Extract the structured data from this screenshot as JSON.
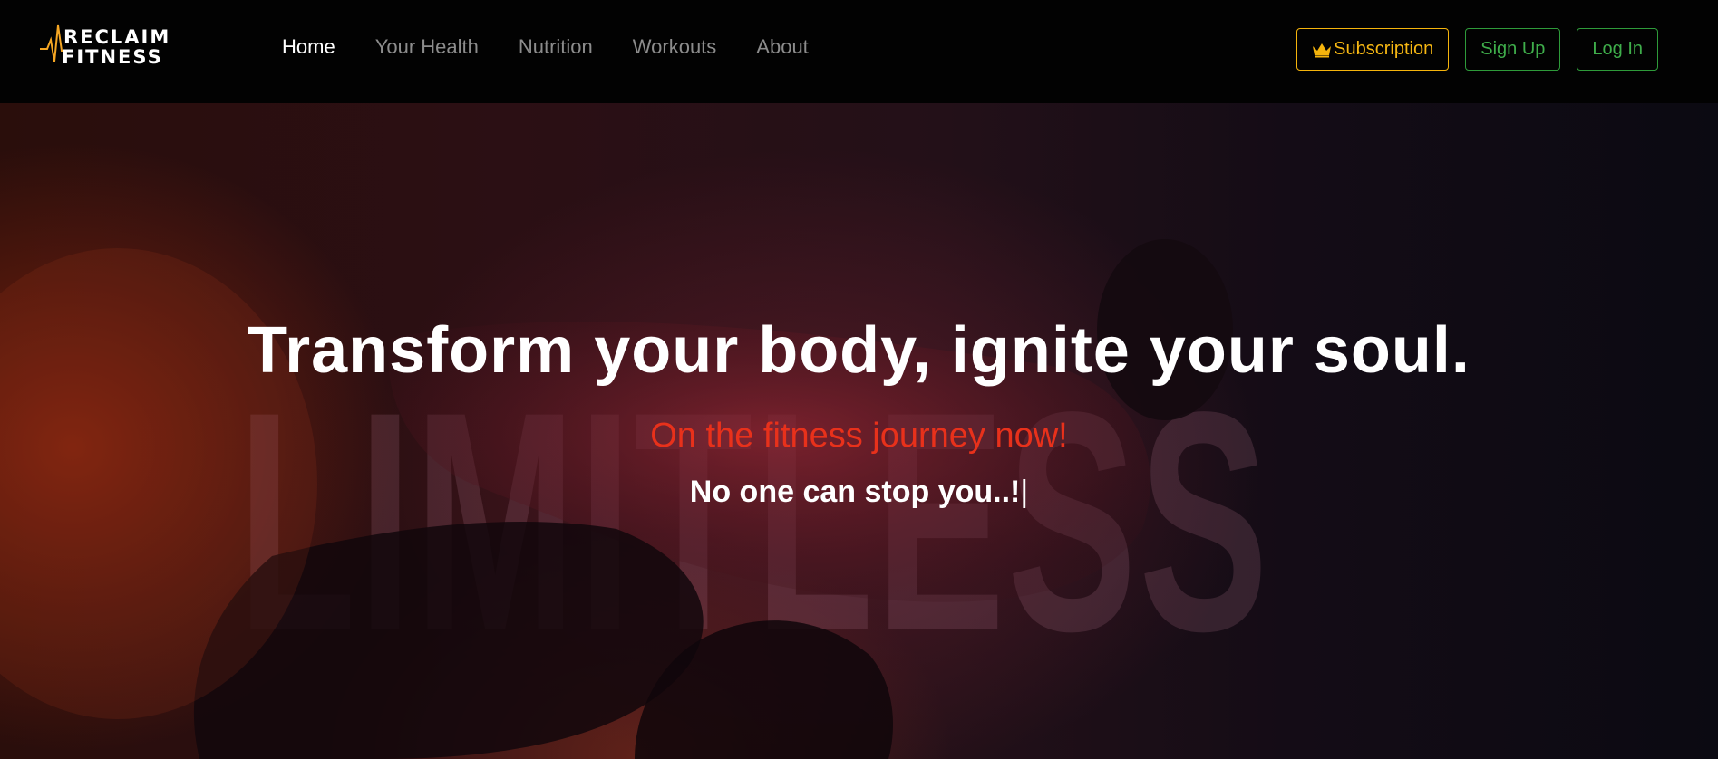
{
  "brand": {
    "line1": "RECLAIM",
    "line2": "FITNESS",
    "accent_color": "#f5a623"
  },
  "nav": {
    "links": [
      {
        "label": "Home",
        "active": true
      },
      {
        "label": "Your Health",
        "active": false
      },
      {
        "label": "Nutrition",
        "active": false
      },
      {
        "label": "Workouts",
        "active": false
      },
      {
        "label": "About",
        "active": false
      }
    ],
    "subscription_label": "Subscription",
    "subscription_icon": "crown-icon",
    "signup_label": "Sign Up",
    "login_label": "Log In"
  },
  "hero": {
    "watermark": "LIMITLESS",
    "headline": "Transform your body, ignite your soul.",
    "subheadline": "On the fitness journey now!",
    "tagline": "No one can stop you..!",
    "cursor": "|"
  },
  "colors": {
    "subscription": "#f5b40c",
    "auth_buttons": "#2e9b3a",
    "subheadline": "#e8311b"
  }
}
